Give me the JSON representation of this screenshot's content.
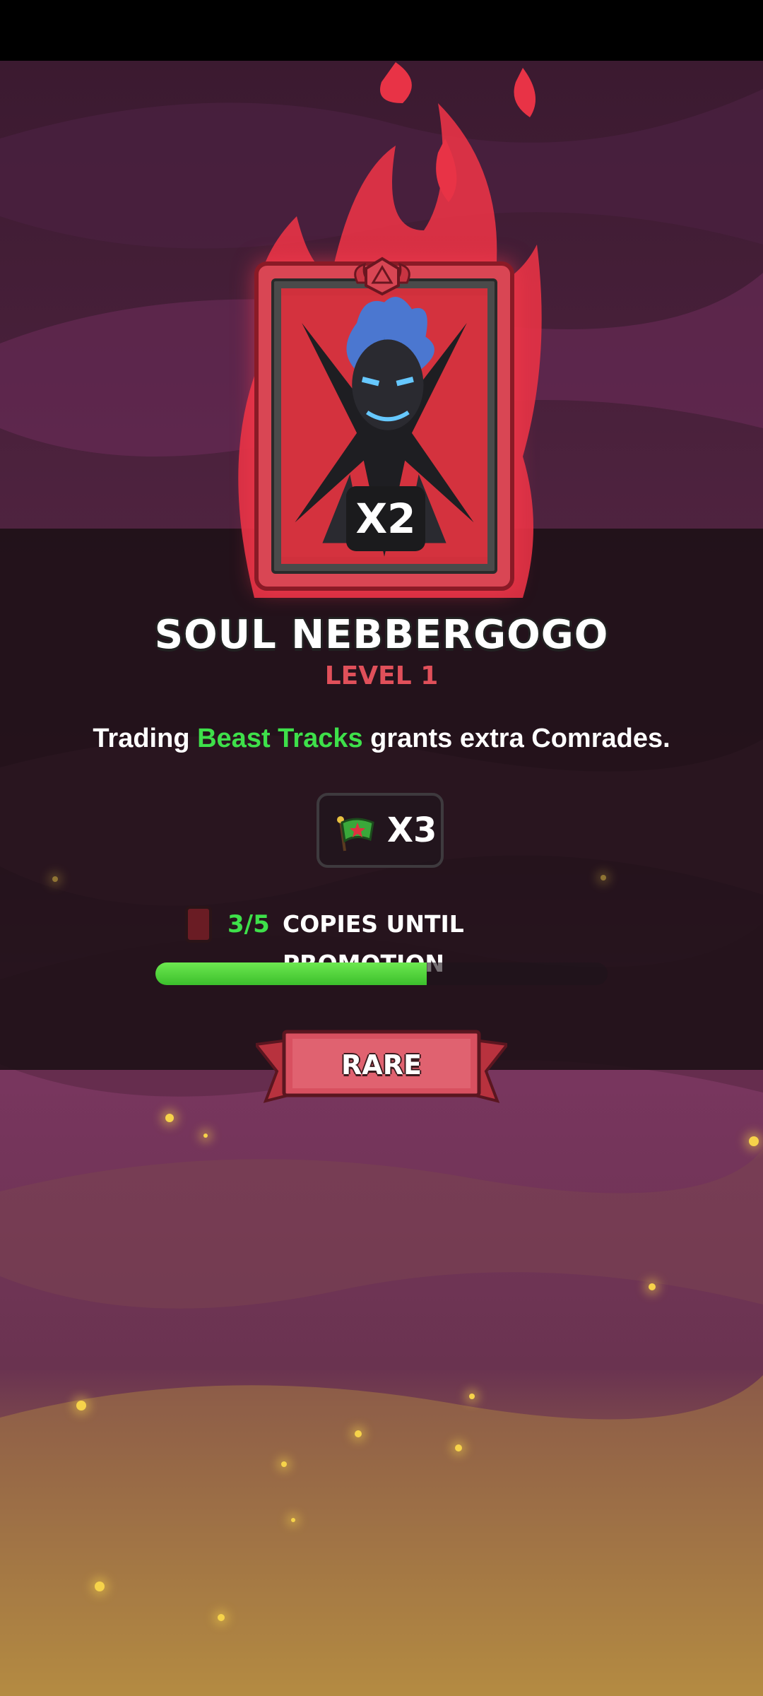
{
  "card": {
    "count_badge": "X2",
    "name": "SOUL NEBBERGOGO",
    "level": "LEVEL 1"
  },
  "description": {
    "prefix": "Trading ",
    "highlight": "Beast Tracks",
    "suffix": " grants extra Comrades."
  },
  "reward": {
    "icon": "flag-icon",
    "count": "X3"
  },
  "promotion": {
    "count": "3/5",
    "label": "COPIES UNTIL PROMOTION",
    "progress": 0.6
  },
  "rarity": {
    "label": "RARE"
  },
  "colors": {
    "highlight_green": "#3ee04a",
    "level_red": "#e0505a",
    "card_red": "#d94654"
  }
}
